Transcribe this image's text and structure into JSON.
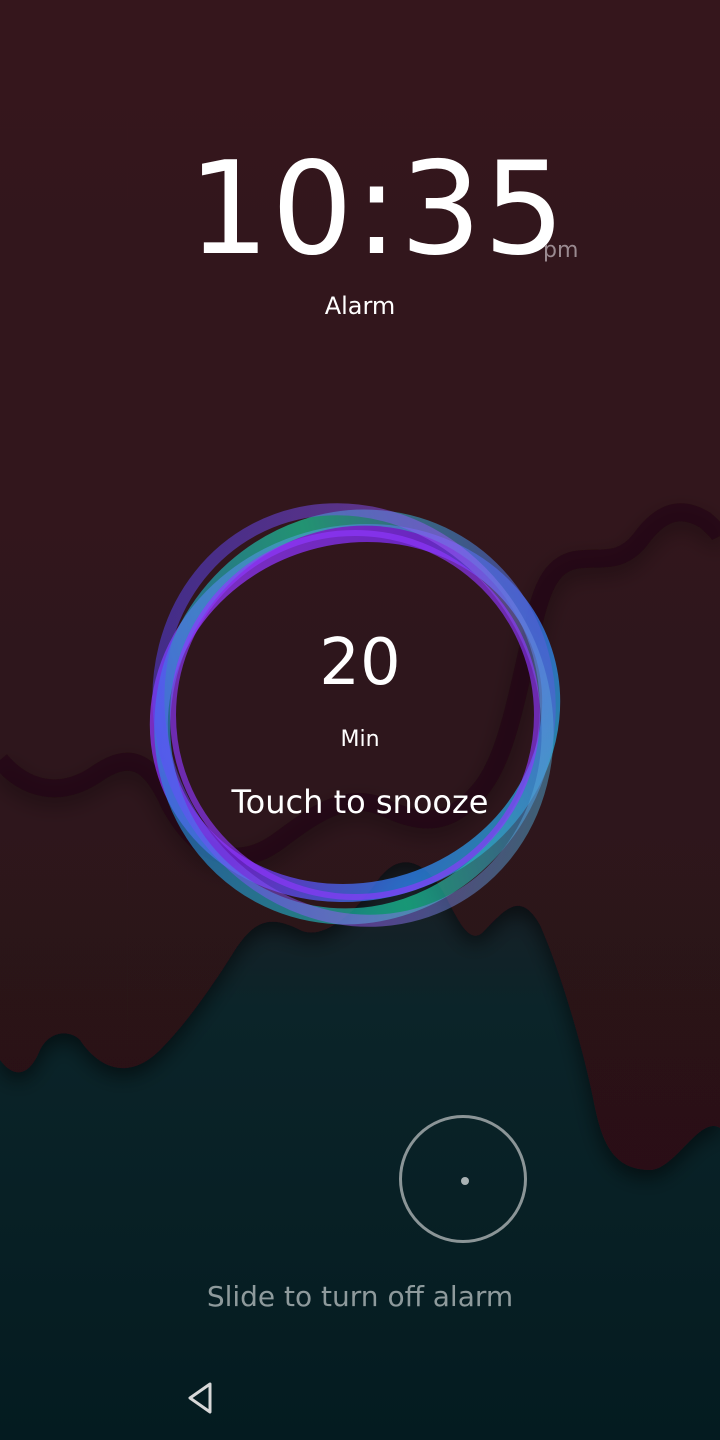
{
  "clock": {
    "time": "10:35",
    "ampm": "pm",
    "label": "Alarm"
  },
  "snooze": {
    "minutes": "20",
    "unit": "Min",
    "action": "Touch to snooze"
  },
  "dismiss": {
    "label": "Slide to turn off alarm",
    "icon": "slide-handle-icon"
  },
  "navigation": {
    "back_icon": "back-triangle-icon"
  },
  "colors": {
    "background_top": "#2f1420",
    "background_bottom": "#041b20",
    "ring_purple": "#8a2be2",
    "ring_teal": "#19d3b8",
    "ring_blue": "#2f8cff",
    "text": "#ffffff",
    "muted_text": "#8e9a9c"
  }
}
